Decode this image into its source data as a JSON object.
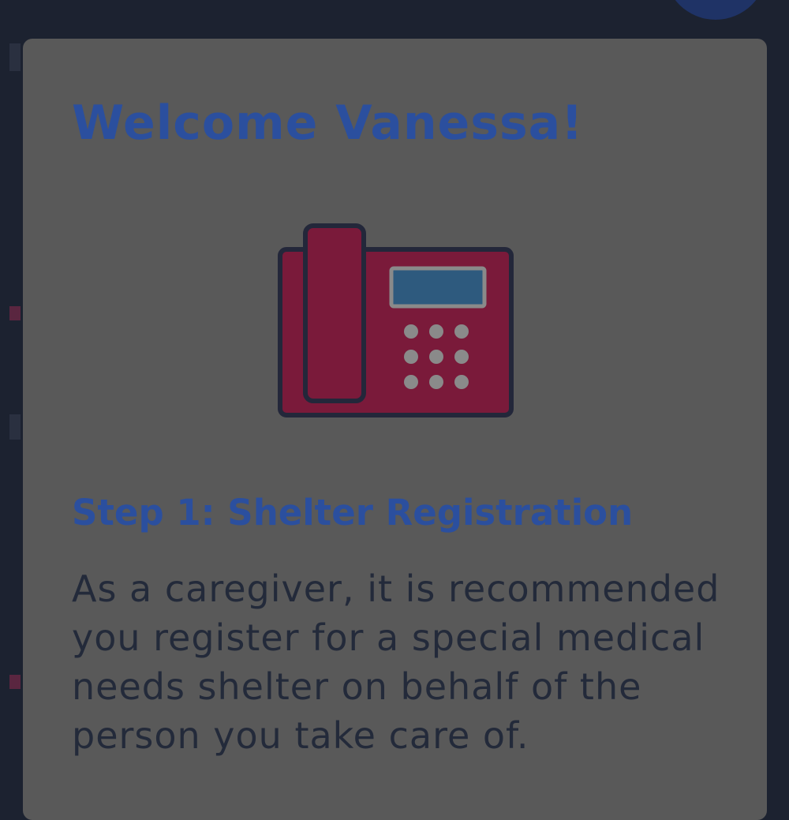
{
  "modal": {
    "title": "Welcome Vanessa!",
    "illustration_icon": "desk-phone-icon",
    "step_title": "Step 1: Shelter Registration",
    "body": "As a caregiver, it is recommended you register for a special medical needs shelter on behalf of the person you take care of."
  },
  "colors": {
    "overlay_background": "#1c2230",
    "modal_background": "#595959",
    "heading": "#2b4f9e",
    "body_text": "#232a3a",
    "phone_body": "#7a1a3a",
    "phone_outline": "#23273a",
    "phone_screen": "#2e5a7e"
  }
}
